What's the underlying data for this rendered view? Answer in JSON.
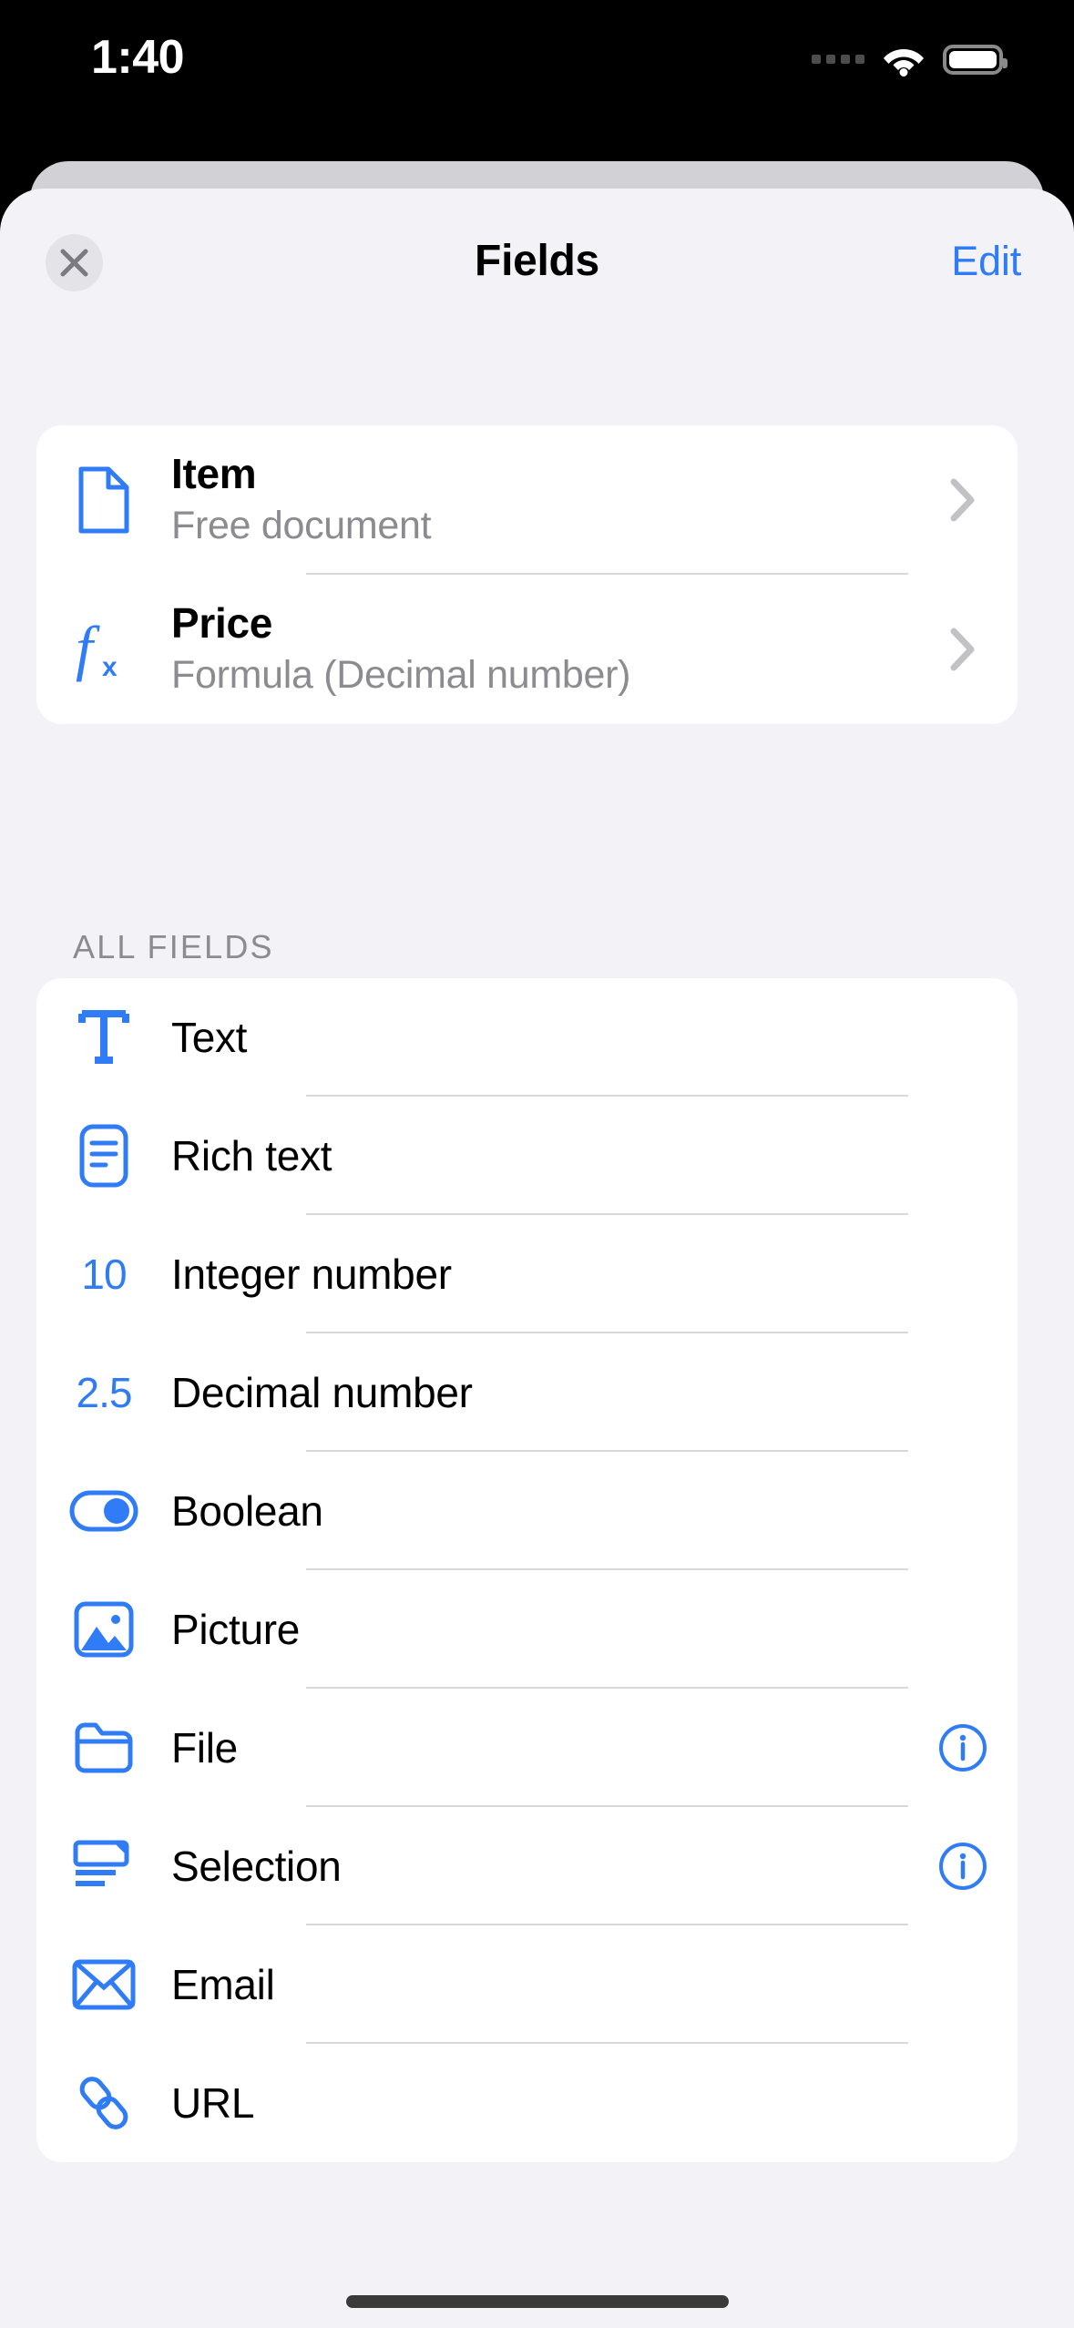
{
  "status_bar": {
    "time": "1:40",
    "cellular_icon": "cellular-dots-icon",
    "wifi_icon": "wifi-icon",
    "battery_icon": "battery-icon"
  },
  "navbar": {
    "close_label": "Close",
    "close_icon": "close-x-icon",
    "title": "Fields",
    "edit_label": "Edit"
  },
  "colors": {
    "accent": "#2f7cf6",
    "sheet_background": "#f2f2f7",
    "card_background": "#ffffff",
    "secondary_text": "#8b8b90",
    "separator": "#d8d8dc"
  },
  "current_fields": [
    {
      "title": "Item",
      "subtitle": "Free document",
      "icon": "document-icon",
      "accessory": "chevron-right-icon"
    },
    {
      "title": "Price",
      "subtitle": "Formula (Decimal number)",
      "icon": "formula-fx-icon",
      "accessory": "chevron-right-icon"
    }
  ],
  "all_fields": {
    "section_label": "ALL FIELDS",
    "items": [
      {
        "title": "Text",
        "icon": "text-t-icon",
        "icon_glyph": "",
        "accessory": null
      },
      {
        "title": "Rich text",
        "icon": "rich-text-icon",
        "icon_glyph": "",
        "accessory": null
      },
      {
        "title": "Integer number",
        "icon": "integer-number-icon",
        "icon_glyph": "10",
        "accessory": null
      },
      {
        "title": "Decimal number",
        "icon": "decimal-number-icon",
        "icon_glyph": "2.5",
        "accessory": null
      },
      {
        "title": "Boolean",
        "icon": "toggle-switch-icon",
        "icon_glyph": "",
        "accessory": null
      },
      {
        "title": "Picture",
        "icon": "picture-icon",
        "icon_glyph": "",
        "accessory": null
      },
      {
        "title": "File",
        "icon": "folder-icon",
        "icon_glyph": "",
        "accessory": "info-circle-icon"
      },
      {
        "title": "Selection",
        "icon": "selection-list-icon",
        "icon_glyph": "",
        "accessory": "info-circle-icon"
      },
      {
        "title": "Email",
        "icon": "envelope-icon",
        "icon_glyph": "",
        "accessory": null
      },
      {
        "title": "URL",
        "icon": "link-chain-icon",
        "icon_glyph": "",
        "accessory": null
      }
    ]
  },
  "home_indicator": "home-indicator"
}
